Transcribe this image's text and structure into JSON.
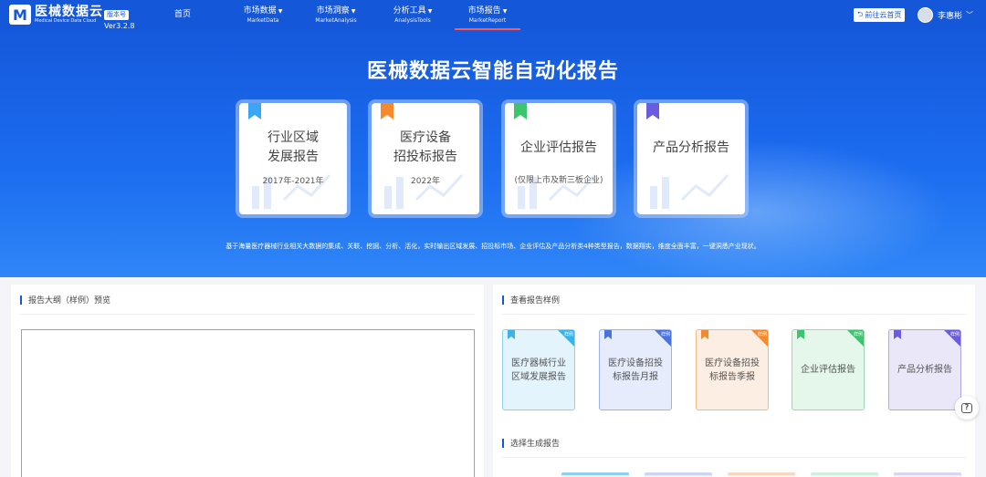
{
  "brand": {
    "mark": "M",
    "name_cn": "医械数据云",
    "name_en": "Medical Device Data Cloud",
    "version_badge": "版本号",
    "version": "Ver3.2.8",
    "color": "#1557d9"
  },
  "nav": {
    "items": [
      {
        "cn": "首页",
        "en": ""
      },
      {
        "cn": "市场数据",
        "en": "MarketData"
      },
      {
        "cn": "市场洞察",
        "en": "MarketAnalysis"
      },
      {
        "cn": "分析工具",
        "en": "AnalysisTools"
      },
      {
        "cn": "市场报告",
        "en": "MarketReport"
      }
    ],
    "active_index": 4,
    "active_color": "#ff5a5a",
    "home_link": "前往云首页",
    "home_link_icon": "exit-arrow-icon",
    "user_name": "李惠彬"
  },
  "hero": {
    "title": "医械数据云智能自动化报告",
    "cards": [
      {
        "title_line1": "行业区域",
        "title_line2": "发展报告",
        "sub": "2017年-2021年",
        "ribbon_color": "#3aa6f5"
      },
      {
        "title_line1": "医疗设备",
        "title_line2": "招投标报告",
        "sub": "2022年",
        "ribbon_color": "#f5892c"
      },
      {
        "title_line1": "企业评估报告",
        "title_line2": "",
        "sub": "(仅限上市及新三板企业)",
        "ribbon_color": "#3cc56d"
      },
      {
        "title_line1": "产品分析报告",
        "title_line2": "",
        "sub": "",
        "ribbon_color": "#6a5ce0"
      }
    ],
    "description": "基于海量医疗器械行业相关大数据的集成、关联、挖掘、分析、活化，实时输出区域发展、招投标市场、企业评估及产品分析类4种类型报告，数据翔实，维度全面丰富，一键洞悉产业现状。"
  },
  "outline": {
    "title": "报告大纲（样例）预览"
  },
  "samples": {
    "title": "查看报告样例",
    "tag": "样例",
    "cards": [
      {
        "line1": "医疗器械行业",
        "line2": "区域发展报告",
        "bg": "#e4f4fc",
        "border": "#8fd0f0",
        "accent": "#3ab3ea"
      },
      {
        "line1": "医疗设备招投",
        "line2": "标报告月报",
        "bg": "#e6ecfb",
        "border": "#9db2ea",
        "accent": "#4b73dd"
      },
      {
        "line1": "医疗设备招投",
        "line2": "标报告季报",
        "bg": "#fdeee3",
        "border": "#f3b98d",
        "accent": "#f58a2c"
      },
      {
        "line1": "企业评估报告",
        "line2": "",
        "bg": "#e5f6ea",
        "border": "#9dd9b0",
        "accent": "#3cc56d"
      },
      {
        "line1": "产品分析报告",
        "line2": "",
        "bg": "#e9e7f8",
        "border": "#b0a8e6",
        "accent": "#6a5ce0"
      }
    ]
  },
  "generate": {
    "title": "选择生成报告",
    "tabs": [
      {
        "color": "#8fd0f0"
      },
      {
        "color": "#c9d5f3"
      },
      {
        "color": "#f8d8c0"
      },
      {
        "color": "#cfeedd"
      },
      {
        "color": "#d9d5f3"
      }
    ]
  },
  "help": {
    "icon": "help-chat-icon",
    "glyph": "?"
  }
}
